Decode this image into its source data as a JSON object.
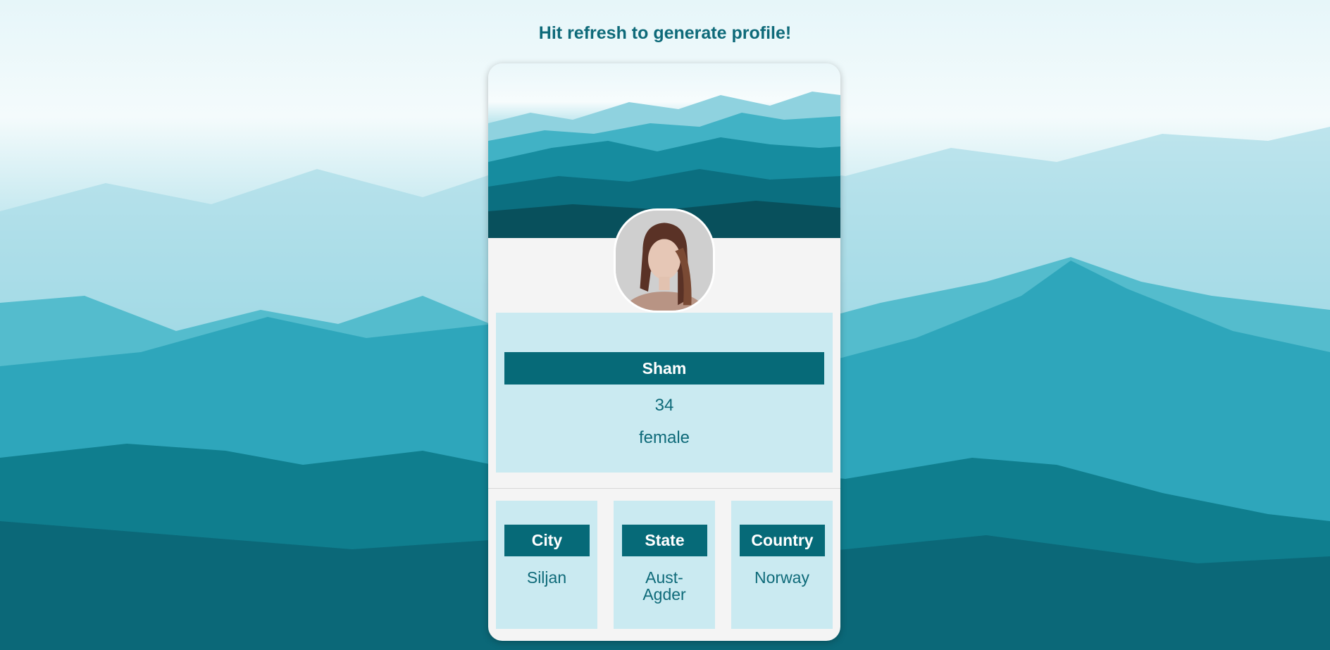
{
  "page": {
    "heading": "Hit refresh to generate profile!"
  },
  "profile": {
    "name": "Sham",
    "age": "34",
    "gender": "female",
    "avatar_icon": "profile-photo"
  },
  "location": {
    "city_label": "City",
    "city_value": "Siljan",
    "state_label": "State",
    "state_value": "Aust-Agder",
    "country_label": "Country",
    "country_value": "Norway"
  },
  "colors": {
    "accent": "#066a78",
    "panel": "#caeaf1",
    "card": "#f4f4f4",
    "text": "#0e6a79"
  }
}
